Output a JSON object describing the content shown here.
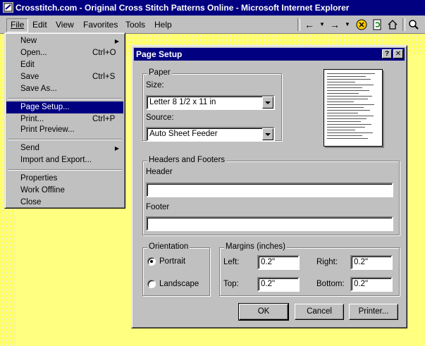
{
  "window": {
    "title": "Crosstitch.com - Original Cross Stitch Patterns Online - Microsoft Internet Explorer"
  },
  "menubar": {
    "items": [
      "File",
      "Edit",
      "View",
      "Favorites",
      "Tools",
      "Help"
    ]
  },
  "toolbar": {
    "icons": [
      "back-arrow-icon",
      "forward-arrow-icon",
      "stop-icon",
      "refresh-icon",
      "home-icon",
      "search-icon"
    ]
  },
  "file_menu": {
    "new": {
      "label": "New"
    },
    "open": {
      "label": "Open...",
      "shortcut": "Ctrl+O"
    },
    "edit": {
      "label": "Edit"
    },
    "save": {
      "label": "Save",
      "shortcut": "Ctrl+S"
    },
    "save_as": {
      "label": "Save As..."
    },
    "page_setup": {
      "label": "Page Setup..."
    },
    "print": {
      "label": "Print...",
      "shortcut": "Ctrl+P"
    },
    "print_preview": {
      "label": "Print Preview..."
    },
    "send": {
      "label": "Send"
    },
    "import_export": {
      "label": "Import and Export..."
    },
    "properties": {
      "label": "Properties"
    },
    "work_offline": {
      "label": "Work Offline"
    },
    "close": {
      "label": "Close"
    }
  },
  "dialog": {
    "title": "Page Setup",
    "help_button": "?",
    "close_button": "✕",
    "paper": {
      "group_label": "Paper",
      "size_label": "Size:",
      "size_value": "Letter 8 1/2 x 11 in",
      "source_label": "Source:",
      "source_value": "Auto Sheet Feeder"
    },
    "headers_footers": {
      "group_label": "Headers and Footers",
      "header_label": "Header",
      "header_value": "",
      "footer_label": "Footer",
      "footer_value": ""
    },
    "orientation": {
      "group_label": "Orientation",
      "portrait": "Portrait",
      "landscape": "Landscape",
      "selected": "Portrait"
    },
    "margins": {
      "group_label": "Margins (inches)",
      "left_label": "Left:",
      "left_value": "0.2\"",
      "right_label": "Right:",
      "right_value": "0.2\"",
      "top_label": "Top:",
      "top_value": "0.2\"",
      "bottom_label": "Bottom:",
      "bottom_value": "0.2\""
    },
    "buttons": {
      "ok": "OK",
      "cancel": "Cancel",
      "printer": "Printer..."
    }
  },
  "colors": {
    "titlebar": "#000080",
    "face": "#c0c0c0",
    "page": "#ffff80",
    "highlight": "#000080"
  }
}
